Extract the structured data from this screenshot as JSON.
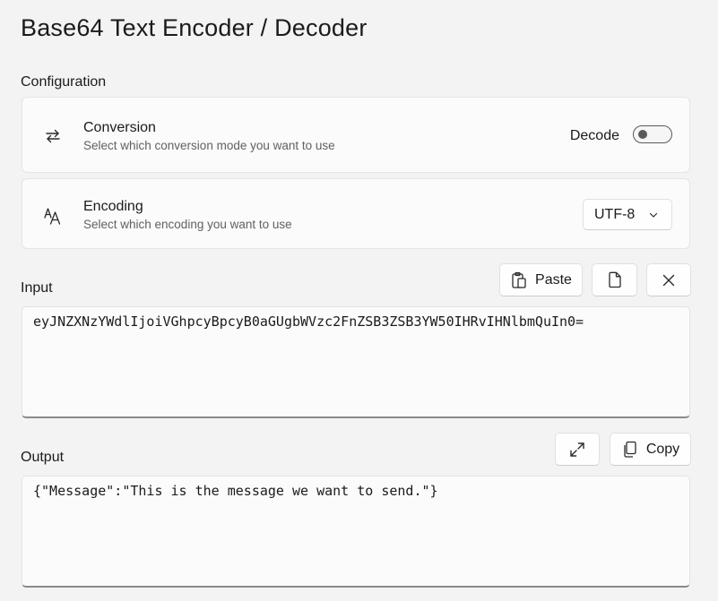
{
  "header": {
    "title": "Base64 Text Encoder / Decoder"
  },
  "configuration": {
    "section_label": "Configuration",
    "conversion": {
      "title": "Conversion",
      "description": "Select which conversion mode you want to use",
      "toggle_label": "Decode",
      "toggle_on": false,
      "icon": "swap-arrows-icon"
    },
    "encoding": {
      "title": "Encoding",
      "description": "Select which encoding you want to use",
      "selected_value": "UTF-8",
      "icon": "font-size-icon"
    }
  },
  "input": {
    "section_label": "Input",
    "paste_label": "Paste",
    "value": "eyJNZXNzYWdlIjoiVGhpcyBpcyB0aGUgbWVzc2FnZSB3ZSB3YW50IHRvIHNlbmQuIn0="
  },
  "output": {
    "section_label": "Output",
    "copy_label": "Copy",
    "value": "{\"Message\":\"This is the message we want to send.\"}"
  }
}
